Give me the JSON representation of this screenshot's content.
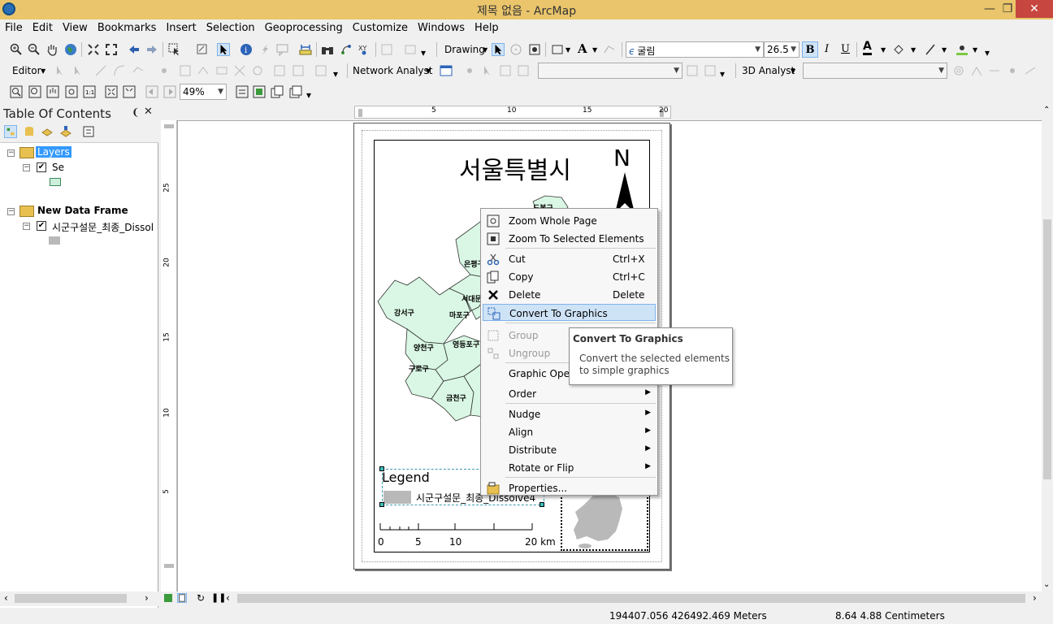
{
  "window": {
    "title": "제목 없음 - ArcMap"
  },
  "menubar": [
    "File",
    "Edit",
    "View",
    "Bookmarks",
    "Insert",
    "Selection",
    "Geoprocessing",
    "Customize",
    "Windows",
    "Help"
  ],
  "toolbar1": {
    "drawing_label": "Drawing",
    "font_name": "굴림",
    "font_size": "26.5",
    "bold": "B",
    "italic": "I",
    "underline": "U",
    "font_color_letter": "A"
  },
  "toolbar2": {
    "editor_label": "Editor",
    "network_analyst_label": "Network Analyst",
    "analyst3d_label": "3D Analyst"
  },
  "toolbar3": {
    "zoom_value": "49%"
  },
  "toc": {
    "title": "Table Of Contents",
    "frames": [
      {
        "name": "Layers",
        "layer": "Se",
        "swatch": "#ccefdc"
      },
      {
        "name": "New Data Frame",
        "layer": "시군구설문_최종_Dissol",
        "swatch": "#b9b9b9"
      }
    ]
  },
  "rulers": {
    "h_ticks": [
      "5",
      "10",
      "15",
      "20"
    ],
    "v_ticks": [
      "25",
      "20",
      "15",
      "10",
      "5"
    ]
  },
  "map": {
    "title": "서울특별시",
    "north": "N",
    "districts": [
      "강서구",
      "양천구",
      "구로구",
      "금천구",
      "영등포구",
      "마포구",
      "은평구",
      "서대문구",
      "도봉구"
    ],
    "legend_title": "Legend",
    "legend_item": "시군구설문_최종_Dissolve4",
    "scale_labels": [
      "0",
      "5",
      "10",
      "20 km"
    ],
    "fill_color": "#d9f7e4"
  },
  "context_menu": {
    "items": [
      {
        "label": "Zoom Whole Page",
        "accel": "",
        "icon": "zoom-page-icon",
        "disabled": false,
        "sub": false
      },
      {
        "label": "Zoom To Selected Elements",
        "accel": "",
        "icon": "zoom-selected-icon",
        "disabled": false,
        "sub": false
      },
      {
        "label": "Cut",
        "accel": "Ctrl+X",
        "icon": "scissors-icon",
        "disabled": false,
        "sub": false
      },
      {
        "label": "Copy",
        "accel": "Ctrl+C",
        "icon": "copy-icon",
        "disabled": false,
        "sub": false
      },
      {
        "label": "Delete",
        "accel": "Delete",
        "icon": "delete-x-icon",
        "disabled": false,
        "sub": false
      },
      {
        "label": "Convert To Graphics",
        "accel": "",
        "icon": "convert-graphics-icon",
        "disabled": false,
        "sub": false,
        "highlight": true
      },
      {
        "label": "Group",
        "accel": "",
        "icon": "group-icon",
        "disabled": true,
        "sub": false
      },
      {
        "label": "Ungroup",
        "accel": "",
        "icon": "ungroup-icon",
        "disabled": true,
        "sub": false
      },
      {
        "label": "Graphic Operations",
        "accel": "",
        "icon": "",
        "disabled": false,
        "sub": true
      },
      {
        "label": "Order",
        "accel": "",
        "icon": "",
        "disabled": false,
        "sub": true
      },
      {
        "label": "Nudge",
        "accel": "",
        "icon": "",
        "disabled": false,
        "sub": true
      },
      {
        "label": "Align",
        "accel": "",
        "icon": "",
        "disabled": false,
        "sub": true
      },
      {
        "label": "Distribute",
        "accel": "",
        "icon": "",
        "disabled": false,
        "sub": true
      },
      {
        "label": "Rotate or Flip",
        "accel": "",
        "icon": "",
        "disabled": false,
        "sub": true
      },
      {
        "label": "Properties...",
        "accel": "",
        "icon": "properties-icon",
        "disabled": false,
        "sub": false
      }
    ]
  },
  "tooltip": {
    "title": "Convert To Graphics",
    "description": "Convert the selected elements to simple graphics"
  },
  "status": {
    "coords": "194407.056  426492.469 Meters",
    "page_coords": "8.64  4.88 Centimeters"
  }
}
